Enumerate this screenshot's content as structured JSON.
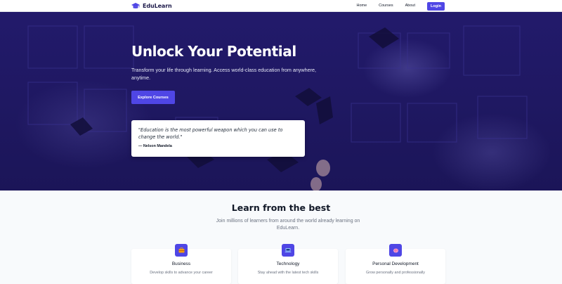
{
  "nav": {
    "brand": "EduLearn",
    "links": [
      "Home",
      "Courses",
      "About"
    ],
    "login_label": "Login"
  },
  "hero": {
    "title": "Unlock Your Potential",
    "subtitle": "Transform your life through learning. Access world-class education from anywhere, anytime.",
    "cta_label": "Explore Courses",
    "quote": {
      "text": "\"Education is the most powerful weapon which you can use to change the world.\"",
      "author": "— Nelson Mandela"
    }
  },
  "features": {
    "title": "Learn from the best",
    "subtitle": "Join millions of learners from around the world already learning on EduLearn.",
    "cards": [
      {
        "icon": "briefcase-icon",
        "title": "Business",
        "description": "Develop skills to advance your career"
      },
      {
        "icon": "laptop-icon",
        "title": "Technology",
        "description": "Stay ahead with the latest tech skills"
      },
      {
        "icon": "brain-icon",
        "title": "Personal Development",
        "description": "Grow personally and professionally"
      }
    ]
  },
  "colors": {
    "primary": "#4f46e5",
    "hero_overlay": "#221a6b",
    "page_background": "#f8fafc",
    "heading": "#111827"
  }
}
